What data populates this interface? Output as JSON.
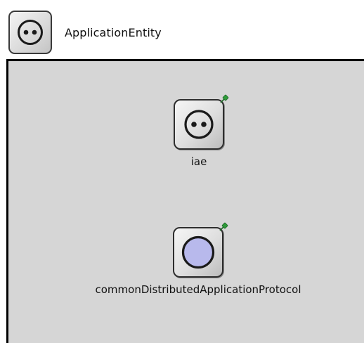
{
  "header": {
    "title": "ApplicationEntity",
    "icon": "face-icon"
  },
  "submodules": [
    {
      "label": "iae",
      "icon": "face-icon",
      "pin": "pushpin-icon"
    },
    {
      "label": "commonDistributedApplicationProtocol",
      "icon": "circle-icon",
      "pin": "pushpin-icon",
      "color": "#b8b9ec"
    }
  ],
  "colors": {
    "canvas": "#d6d6d6",
    "border": "#000000",
    "pin": "#2e9b3a"
  }
}
